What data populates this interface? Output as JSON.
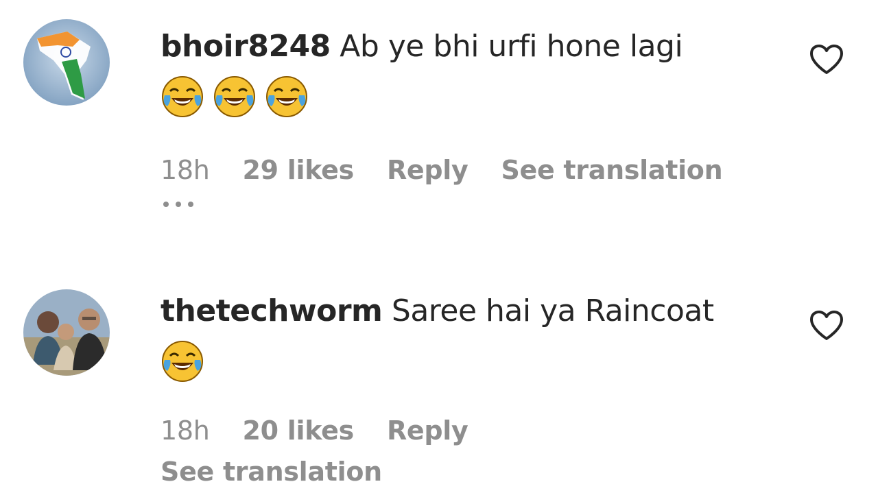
{
  "comments": [
    {
      "username": "bhoir8248",
      "text": "Ab ye bhi urfi hone lagi",
      "emojis": [
        "face-with-tears-of-joy",
        "face-with-tears-of-joy",
        "face-with-tears-of-joy"
      ],
      "time": "18h",
      "likes": "29 likes",
      "reply": "Reply",
      "see_translation": "See translation",
      "avatar": "flag-avatar",
      "like_icon": "heart-outline-icon"
    },
    {
      "username": "thetechworm",
      "text": "Saree hai ya Raincoat",
      "emojis": [
        "face-with-tears-of-joy"
      ],
      "time": "18h",
      "likes": "20 likes",
      "reply": "Reply",
      "see_translation": "See translation",
      "avatar": "group-photo-avatar",
      "like_icon": "heart-outline-icon"
    }
  ],
  "colors": {
    "primary_text": "#262626",
    "secondary_text": "#8e8e8e",
    "emoji_face": "#f7c333",
    "emoji_tear": "#4aa3df"
  }
}
